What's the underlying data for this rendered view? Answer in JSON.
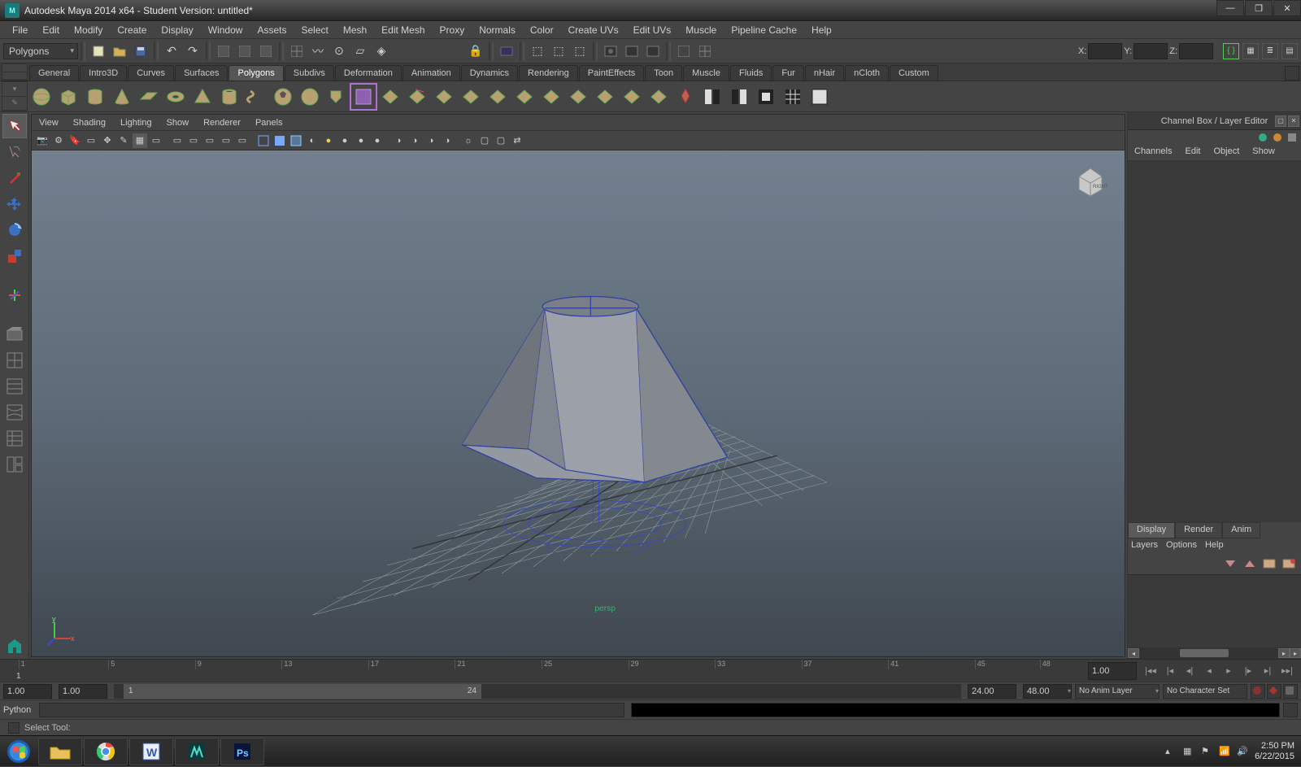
{
  "window": {
    "title": "Autodesk Maya 2014 x64 - Student Version: untitled*"
  },
  "menu": [
    "File",
    "Edit",
    "Modify",
    "Create",
    "Display",
    "Window",
    "Assets",
    "Select",
    "Mesh",
    "Edit Mesh",
    "Proxy",
    "Normals",
    "Color",
    "Create UVs",
    "Edit UVs",
    "Muscle",
    "Pipeline Cache",
    "Help"
  ],
  "mode_selector": "Polygons",
  "xyz": {
    "x": "X:",
    "y": "Y:",
    "z": "Z:"
  },
  "shelf_tabs": [
    "General",
    "Intro3D",
    "Curves",
    "Surfaces",
    "Polygons",
    "Subdivs",
    "Deformation",
    "Animation",
    "Dynamics",
    "Rendering",
    "PaintEffects",
    "Toon",
    "Muscle",
    "Fluids",
    "Fur",
    "nHair",
    "nCloth",
    "Custom"
  ],
  "shelf_active": "Polygons",
  "viewport_menu": [
    "View",
    "Shading",
    "Lighting",
    "Show",
    "Renderer",
    "Panels"
  ],
  "viewcube_face": "RIGHT",
  "right_panel": {
    "title": "Channel Box / Layer Editor",
    "tabs": [
      "Channels",
      "Edit",
      "Object",
      "Show"
    ],
    "display_tabs": [
      "Display",
      "Render",
      "Anim"
    ],
    "display_active": "Display",
    "layer_menu": [
      "Layers",
      "Options",
      "Help"
    ]
  },
  "timeline": {
    "ticks": [
      "1",
      "5",
      "9",
      "13",
      "17",
      "21",
      "25",
      "29",
      "33",
      "37",
      "41",
      "45",
      "48"
    ],
    "current_frame_field": "1.00",
    "current_frame_marker": "1"
  },
  "range": {
    "start_outer": "1.00",
    "start_inner": "1.00",
    "thumb_start": "1",
    "thumb_end": "24",
    "end_inner": "24.00",
    "end_outer": "48.00",
    "anim_layer": "No Anim Layer",
    "char_set": "No Character Set"
  },
  "command": {
    "language": "Python"
  },
  "helpline": "Select Tool:",
  "taskbar": {
    "time": "2:50 PM",
    "date": "6/22/2015"
  }
}
